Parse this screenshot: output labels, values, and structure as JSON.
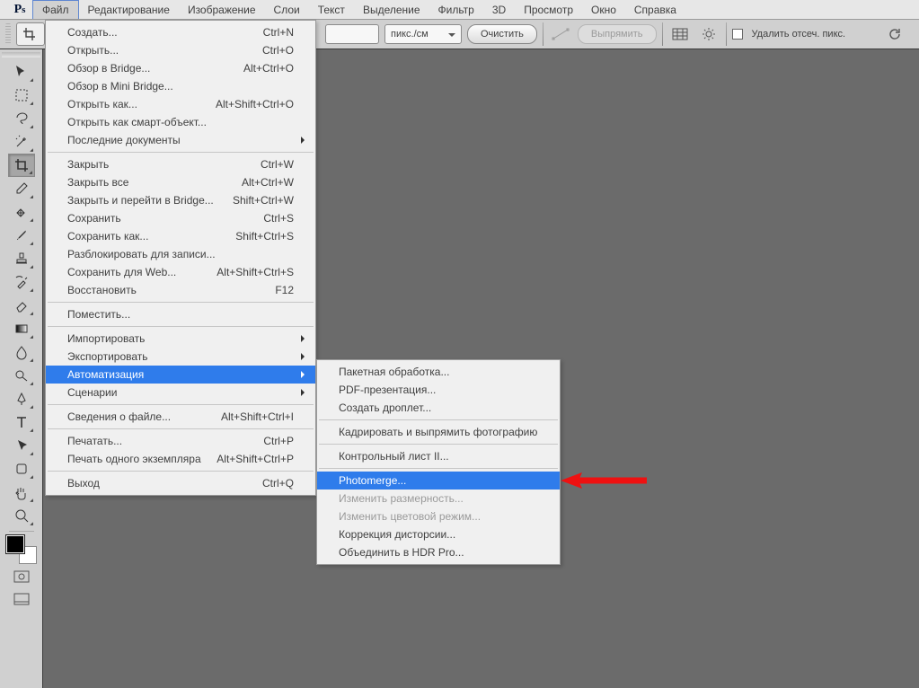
{
  "menubar": {
    "items": [
      "Файл",
      "Редактирование",
      "Изображение",
      "Слои",
      "Текст",
      "Выделение",
      "Фильтр",
      "3D",
      "Просмотр",
      "Окно",
      "Справка"
    ],
    "active_index": 0
  },
  "optionsbar": {
    "unit_value": "пикс./см",
    "clear_label": "Очистить",
    "straighten_label": "Выпрямить",
    "delete_crop_label": "Удалить отсеч. пикс."
  },
  "file_menu": {
    "items": [
      {
        "label": "Создать...",
        "shortcut": "Ctrl+N"
      },
      {
        "label": "Открыть...",
        "shortcut": "Ctrl+O"
      },
      {
        "label": "Обзор в Bridge...",
        "shortcut": "Alt+Ctrl+O"
      },
      {
        "label": "Обзор в Mini Bridge..."
      },
      {
        "label": "Открыть как...",
        "shortcut": "Alt+Shift+Ctrl+O"
      },
      {
        "label": "Открыть как смарт-объект..."
      },
      {
        "label": "Последние документы",
        "sub": true
      },
      {
        "sep": true
      },
      {
        "label": "Закрыть",
        "shortcut": "Ctrl+W"
      },
      {
        "label": "Закрыть все",
        "shortcut": "Alt+Ctrl+W"
      },
      {
        "label": "Закрыть и перейти в Bridge...",
        "shortcut": "Shift+Ctrl+W"
      },
      {
        "label": "Сохранить",
        "shortcut": "Ctrl+S"
      },
      {
        "label": "Сохранить как...",
        "shortcut": "Shift+Ctrl+S"
      },
      {
        "label": "Разблокировать для записи..."
      },
      {
        "label": "Сохранить для Web...",
        "shortcut": "Alt+Shift+Ctrl+S"
      },
      {
        "label": "Восстановить",
        "shortcut": "F12"
      },
      {
        "sep": true
      },
      {
        "label": "Поместить..."
      },
      {
        "sep": true
      },
      {
        "label": "Импортировать",
        "sub": true
      },
      {
        "label": "Экспортировать",
        "sub": true
      },
      {
        "label": "Автоматизация",
        "sub": true,
        "hl": true
      },
      {
        "label": "Сценарии",
        "sub": true
      },
      {
        "sep": true
      },
      {
        "label": "Сведения о файле...",
        "shortcut": "Alt+Shift+Ctrl+I"
      },
      {
        "sep": true
      },
      {
        "label": "Печатать...",
        "shortcut": "Ctrl+P"
      },
      {
        "label": "Печать одного экземпляра",
        "shortcut": "Alt+Shift+Ctrl+P"
      },
      {
        "sep": true
      },
      {
        "label": "Выход",
        "shortcut": "Ctrl+Q"
      }
    ]
  },
  "auto_submenu": {
    "items": [
      {
        "label": "Пакетная обработка..."
      },
      {
        "label": "PDF-презентация..."
      },
      {
        "label": "Создать дроплет..."
      },
      {
        "sep": true
      },
      {
        "label": "Кадрировать и выпрямить фотографию"
      },
      {
        "sep": true
      },
      {
        "label": "Контрольный лист II..."
      },
      {
        "sep": true
      },
      {
        "label": "Photomerge...",
        "hl": true
      },
      {
        "label": "Изменить размерность...",
        "disabled": true
      },
      {
        "label": "Изменить цветовой режим...",
        "disabled": true
      },
      {
        "label": "Коррекция дисторсии..."
      },
      {
        "label": "Объединить в HDR Pro..."
      }
    ]
  },
  "tools": [
    "move",
    "marquee",
    "lasso",
    "wand",
    "crop",
    "eyedropper",
    "heal",
    "brush",
    "stamp",
    "history",
    "eraser",
    "gradient",
    "blur",
    "dodge",
    "pen",
    "type",
    "path-select",
    "shape",
    "hand",
    "zoom"
  ]
}
